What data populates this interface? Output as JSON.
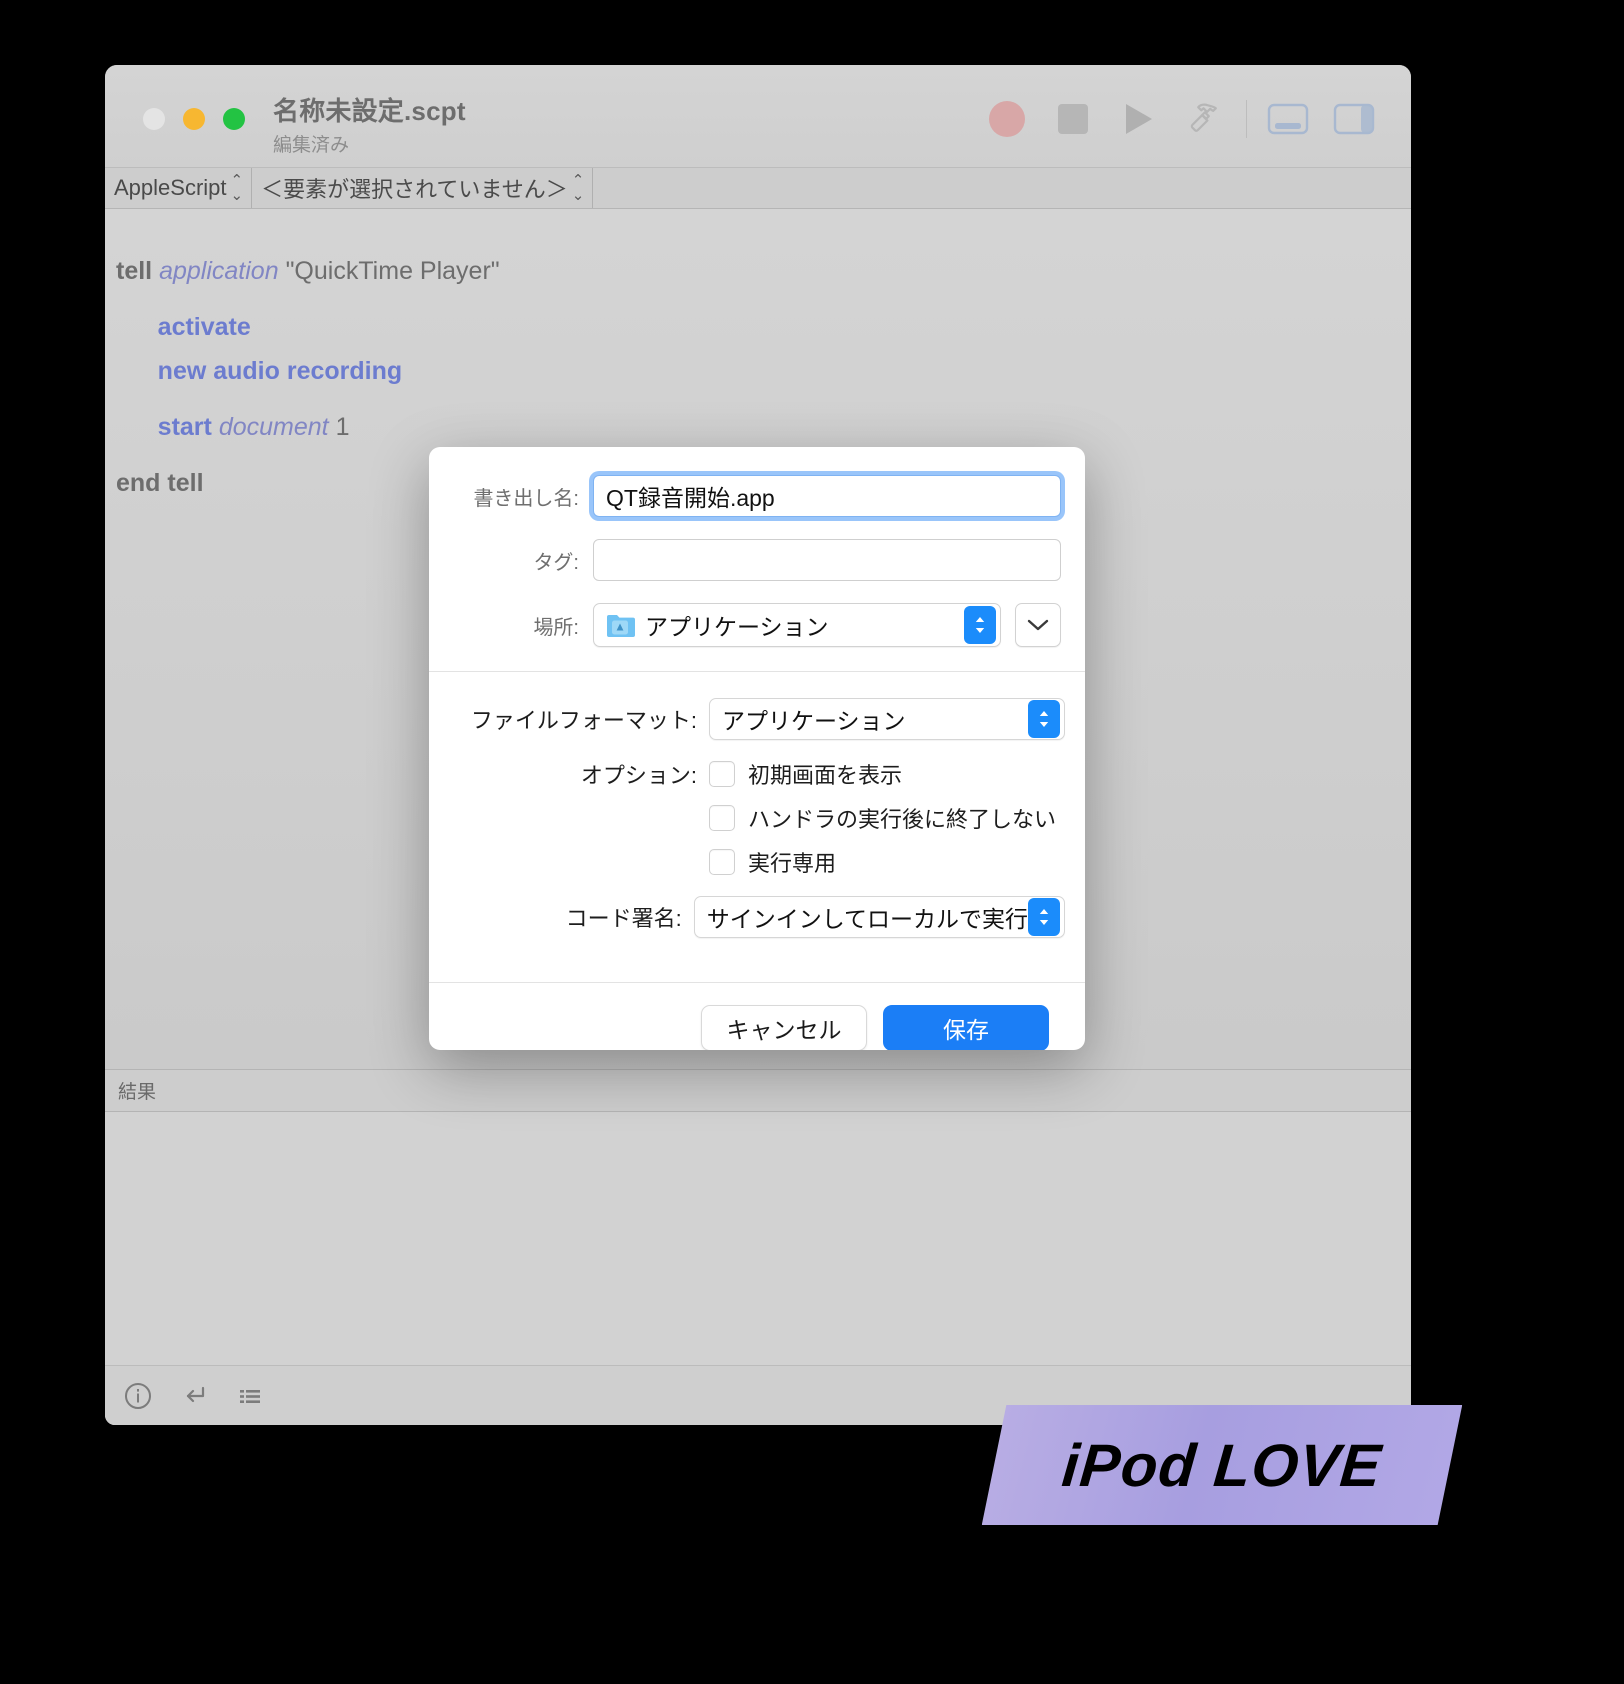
{
  "window": {
    "title": "名称未設定.scpt",
    "subtitle": "編集済み",
    "traffic_lights": [
      "close",
      "minimize",
      "zoom"
    ],
    "toolbar": [
      {
        "name": "record",
        "icon": "record-icon"
      },
      {
        "name": "stop",
        "icon": "stop-icon"
      },
      {
        "name": "run",
        "icon": "play-icon"
      },
      {
        "name": "compile",
        "icon": "hammer-icon"
      },
      {
        "name": "toggle-bottom-panel",
        "icon": "bottom-panel-icon"
      },
      {
        "name": "toggle-right-panel",
        "icon": "right-panel-icon"
      }
    ]
  },
  "navbar": {
    "language": "AppleScript",
    "element": "＜要素が選択されていません＞",
    "stepper_glyph": "⌃⌄"
  },
  "script": {
    "lines": [
      {
        "segments": [
          {
            "t": "tell ",
            "c": "kw"
          },
          {
            "t": "application ",
            "c": "app"
          },
          {
            "t": "\"QuickTime Player\"",
            "c": "str"
          }
        ]
      },
      {
        "blank": true
      },
      {
        "segments": [
          {
            "t": "      activate",
            "c": "cmd"
          }
        ]
      },
      {
        "segments": [
          {
            "t": "      new audio recording",
            "c": "cmd"
          }
        ]
      },
      {
        "blank": true
      },
      {
        "segments": [
          {
            "t": "      start ",
            "c": "cmd"
          },
          {
            "t": "document ",
            "c": "cls"
          },
          {
            "t": "1",
            "c": "num"
          }
        ]
      },
      {
        "blank": true
      },
      {
        "segments": [
          {
            "t": "end tell",
            "c": "kw"
          }
        ]
      }
    ]
  },
  "results": {
    "label": "結果"
  },
  "bottom_bar": {
    "items": [
      {
        "name": "description-icon",
        "glyph": "ⓘ"
      },
      {
        "name": "result-icon",
        "glyph": "↵"
      },
      {
        "name": "event-log-icon",
        "glyph": "☰"
      }
    ]
  },
  "dialog": {
    "export_name_label": "書き出し名:",
    "export_name_value": "QT録音開始.app",
    "tags_label": "タグ:",
    "tags_value": "",
    "tags_placeholder": "",
    "location_label": "場所:",
    "location_value": "アプリケーション",
    "location_icon": "applications-folder-icon",
    "expand_button_glyph": "⌄",
    "file_format_label": "ファイルフォーマット:",
    "file_format_value": "アプリケーション",
    "options_label": "オプション:",
    "options": [
      {
        "label": "初期画面を表示",
        "checked": false
      },
      {
        "label": "ハンドラの実行後に終了しない",
        "checked": false
      },
      {
        "label": "実行専用",
        "checked": false
      }
    ],
    "code_sign_label": "コード署名:",
    "code_sign_value": "サインインしてローカルで実行",
    "cancel_label": "キャンセル",
    "save_label": "保存",
    "accent_color": "#1b7ef6",
    "focus_ring_color": "#4696f6"
  },
  "watermark": {
    "text": "iPod LOVE"
  }
}
